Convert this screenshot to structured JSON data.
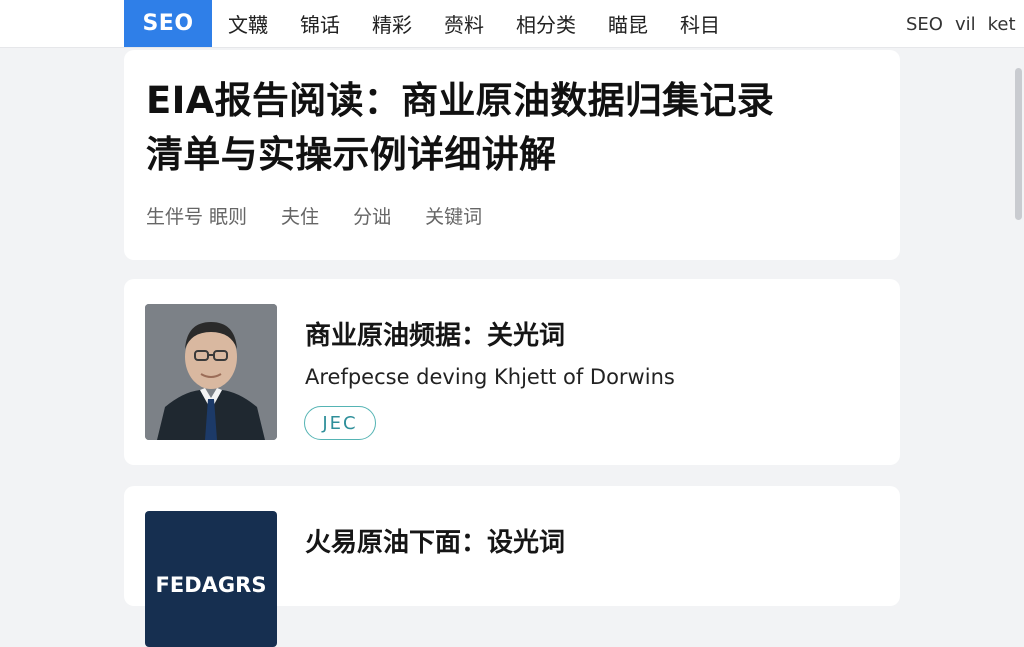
{
  "nav": {
    "brand": "SEO",
    "items": [
      "文韈",
      "锦话",
      "精彩",
      "赍料",
      "相分类",
      "瞄昆",
      "科目"
    ],
    "right": [
      "SEO",
      "vil",
      "ket"
    ]
  },
  "article": {
    "title_line1": "EIA报告阅读：商业原油数据归集记录",
    "title_line2": "清单与实操示例详细讲解",
    "meta": [
      "生伴号 眠则",
      "夫住",
      "分诎",
      "关键词"
    ]
  },
  "list": [
    {
      "title": "商业原油频据：关光词",
      "subtitle": "Arefpecse deving Khjett of Dorwins",
      "tag": "JEC",
      "thumb_icon": "person-portrait-image"
    },
    {
      "title": "火易原油下面：设光词",
      "thumb_text": "FEDAGRS",
      "thumb_icon": "brand-logo-image"
    }
  ],
  "colors": {
    "brand": "#2f7fe8",
    "tag": "#55b4b4",
    "dark_thumb": "#162f50"
  }
}
